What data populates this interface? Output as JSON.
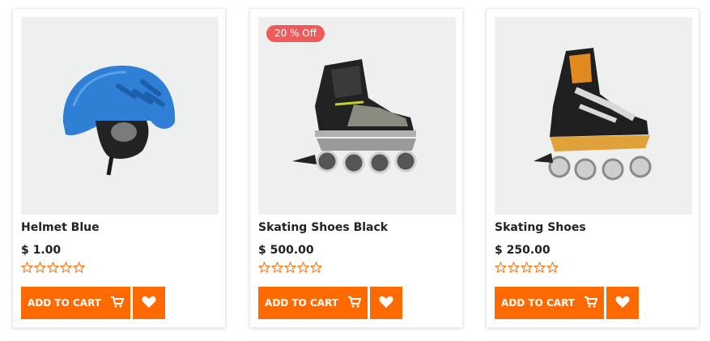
{
  "colors": {
    "accent": "#ff6a00",
    "badge": "#f05a5a",
    "star": "#ff6a00",
    "image_bg": "#eeefef"
  },
  "products": [
    {
      "name": "Helmet Blue",
      "price": "$ 1.00",
      "rating": 0,
      "add_to_cart_label": "ADD TO CART",
      "image_icon": "helmet-image",
      "badge": ""
    },
    {
      "name": "Skating Shoes Black",
      "price": "$ 500.00",
      "rating": 0,
      "add_to_cart_label": "ADD TO CART",
      "image_icon": "inline-skate-image",
      "badge": "20 % Off"
    },
    {
      "name": "Skating Shoes",
      "price": "$ 250.00",
      "rating": 0,
      "add_to_cart_label": "ADD TO CART",
      "image_icon": "inline-skate-image",
      "badge": ""
    }
  ]
}
